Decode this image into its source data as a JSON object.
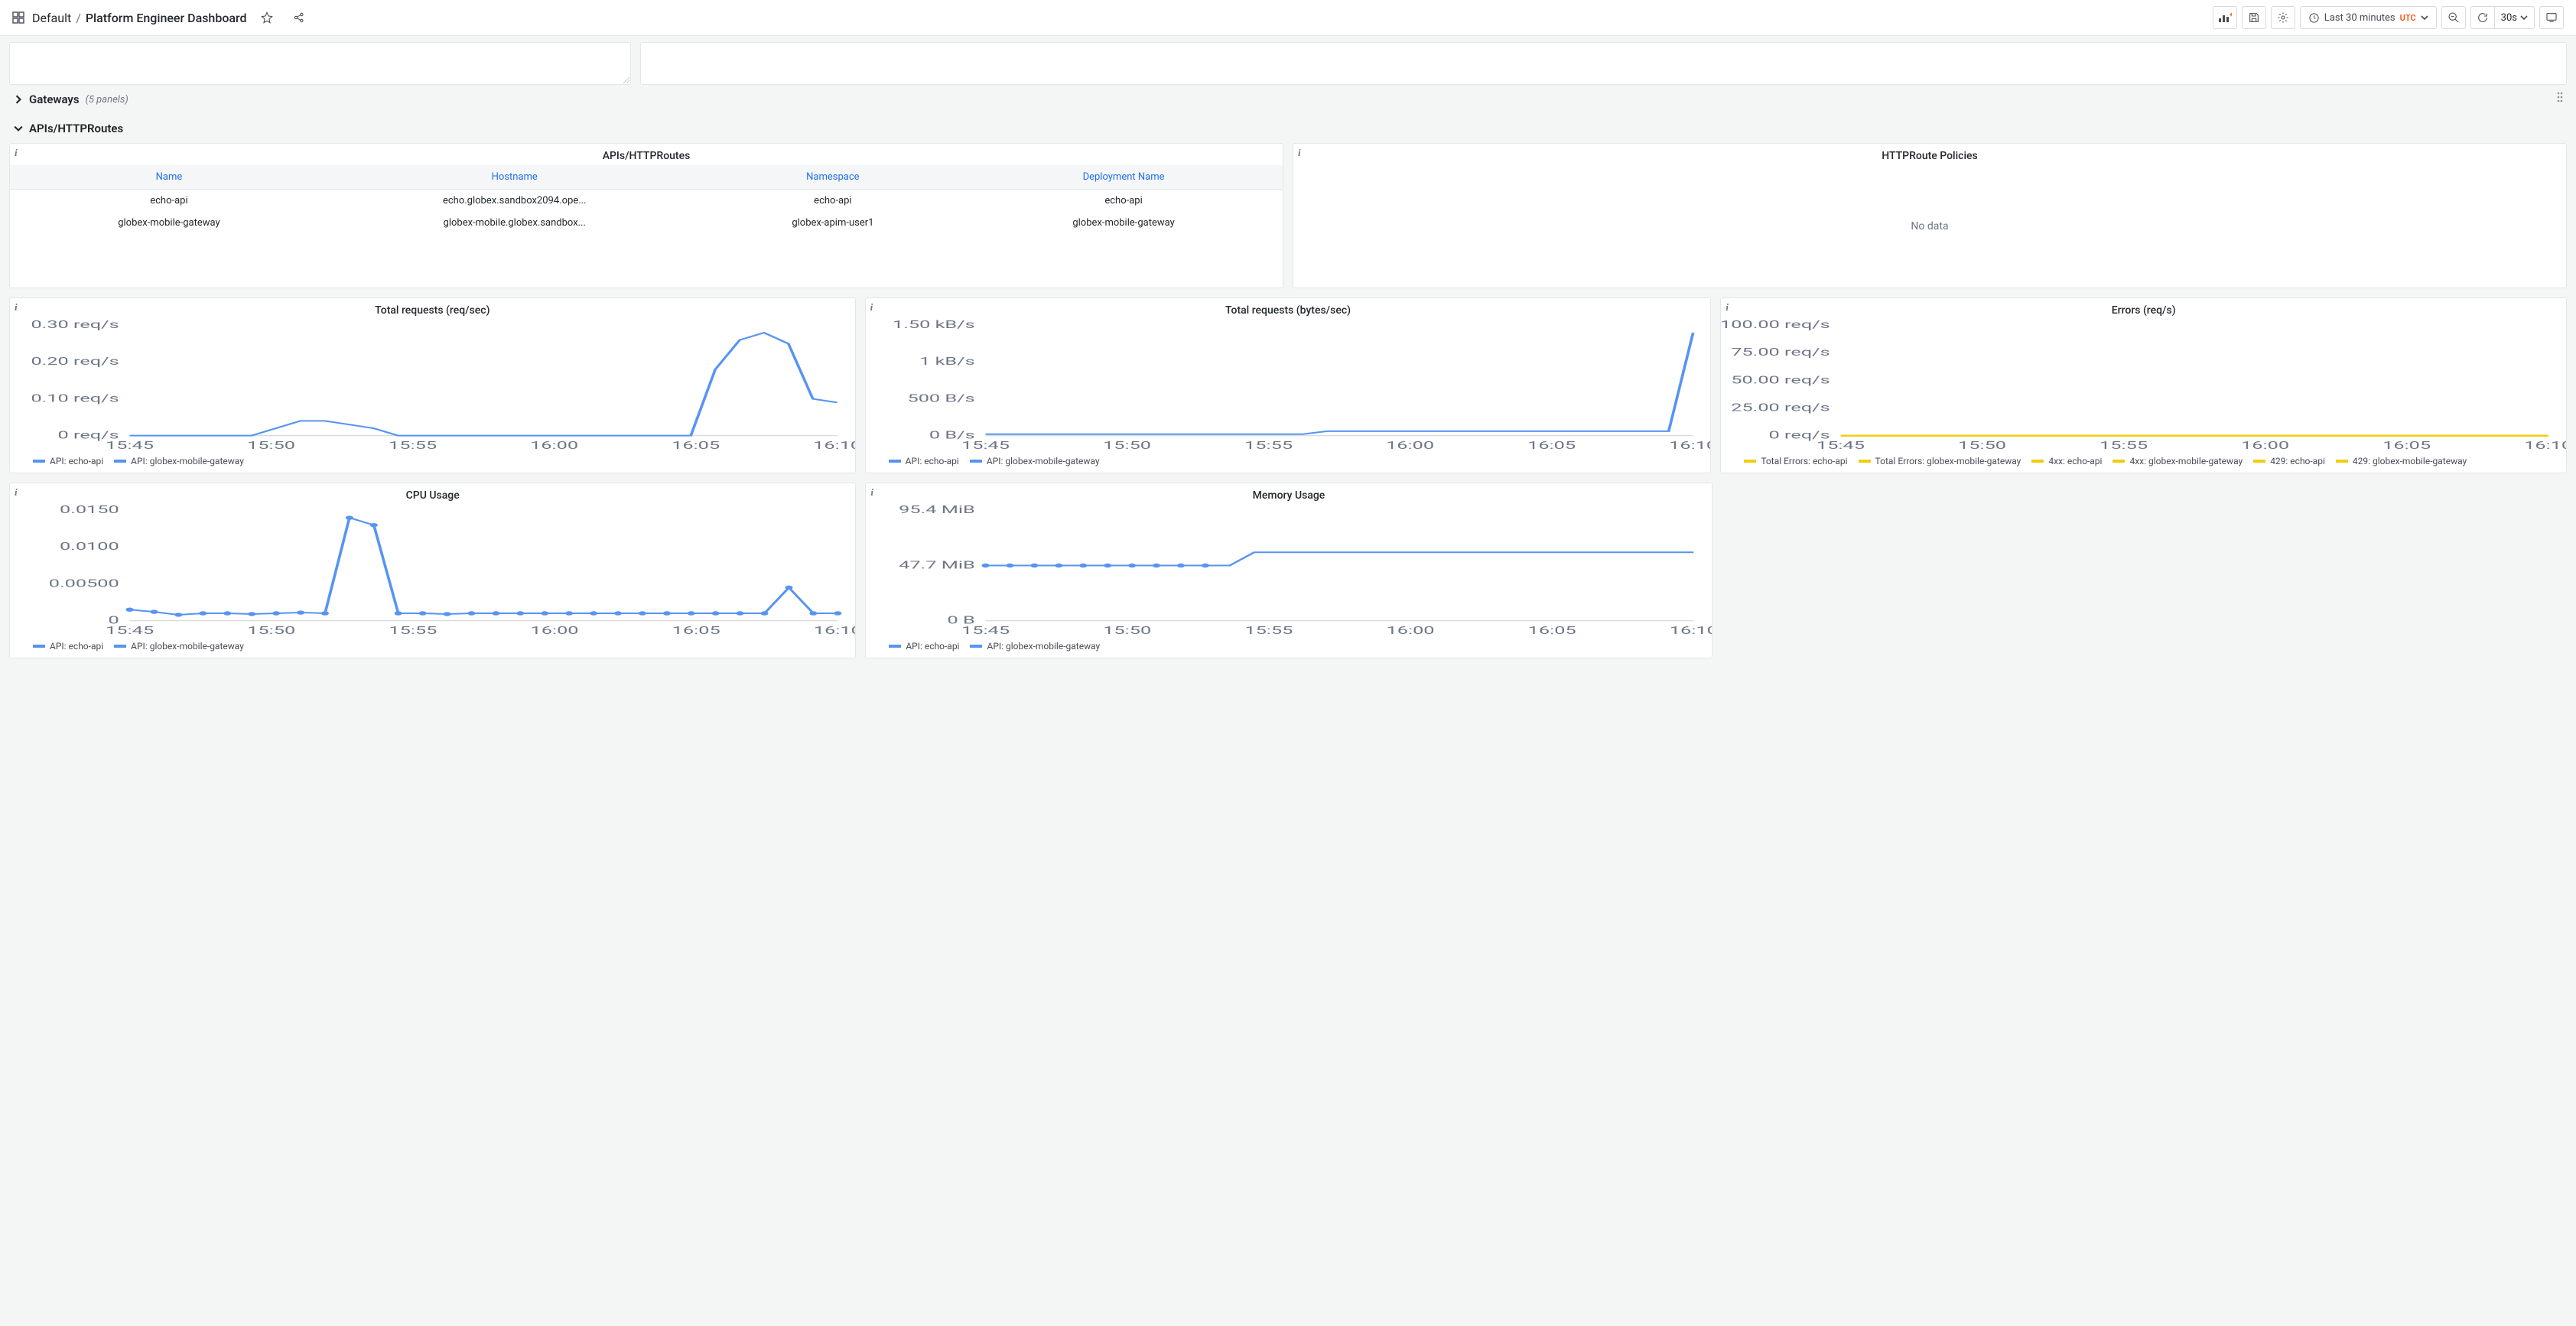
{
  "breadcrumb": {
    "root": "Default",
    "title": "Platform Engineer Dashboard"
  },
  "toolbar": {
    "time_label": "Last 30 minutes",
    "utc": "UTC",
    "refresh_interval": "30s"
  },
  "rows": {
    "gateways": {
      "title": "Gateways",
      "meta": "(5 panels)",
      "collapsed": true
    },
    "apis": {
      "title": "APIs/HTTPRoutes",
      "collapsed": false
    }
  },
  "table_panel": {
    "title": "APIs/HTTPRoutes",
    "headers": [
      "Name",
      "Hostname",
      "Namespace",
      "Deployment Name"
    ],
    "rows": [
      [
        "echo-api",
        "echo.globex.sandbox2094.ope...",
        "echo-api",
        "echo-api"
      ],
      [
        "globex-mobile-gateway",
        "globex-mobile.globex.sandbox...",
        "globex-apim-user1",
        "globex-mobile-gateway"
      ]
    ]
  },
  "policies_panel": {
    "title": "HTTPRoute Policies",
    "no_data": "No data"
  },
  "colors": {
    "blue": "#5794f2",
    "yellow": "#f2cc0c"
  },
  "chart_data": [
    {
      "id": "req_sec",
      "title": "Total requests (req/sec)",
      "type": "line",
      "x_ticks": [
        "15:45",
        "15:50",
        "15:55",
        "16:00",
        "16:05",
        "16:10"
      ],
      "y_ticks": [
        "0 req/s",
        "0.10 req/s",
        "0.20 req/s",
        "0.30 req/s"
      ],
      "ylim": [
        0,
        0.3
      ],
      "series": [
        {
          "name": "API: echo-api",
          "color": "blue",
          "x": [
            0,
            1,
            2,
            3,
            4,
            5,
            6,
            7,
            8,
            9,
            10,
            11,
            12,
            13,
            14,
            15,
            16,
            17,
            18,
            19,
            20,
            21,
            22,
            23,
            24,
            25,
            26,
            27,
            28,
            29
          ],
          "y": [
            0,
            0,
            0,
            0,
            0,
            0,
            0.02,
            0.04,
            0.04,
            0.03,
            0.02,
            0,
            0,
            0,
            0,
            0,
            0,
            0,
            0,
            0,
            0,
            0,
            0,
            0,
            0.18,
            0.26,
            0.28,
            0.25,
            0.1,
            0.09
          ]
        },
        {
          "name": "API: globex-mobile-gateway",
          "color": "blue",
          "x": [],
          "y": []
        }
      ]
    },
    {
      "id": "bytes_sec",
      "title": "Total requests (bytes/sec)",
      "type": "line",
      "x_ticks": [
        "15:45",
        "15:50",
        "15:55",
        "16:00",
        "16:05",
        "16:10"
      ],
      "y_ticks": [
        "0 B/s",
        "500 B/s",
        "1 kB/s",
        "1.50 kB/s"
      ],
      "ylim": [
        0,
        1500
      ],
      "series": [
        {
          "name": "API: echo-api",
          "color": "blue",
          "x": [
            0,
            1,
            2,
            3,
            4,
            5,
            6,
            7,
            8,
            9,
            10,
            11,
            12,
            13,
            14,
            15,
            16,
            17,
            18,
            19,
            20,
            21,
            22,
            23,
            24,
            25,
            26,
            27,
            28,
            29
          ],
          "y": [
            20,
            20,
            20,
            20,
            20,
            20,
            20,
            20,
            20,
            20,
            20,
            20,
            20,
            20,
            60,
            60,
            60,
            60,
            60,
            60,
            60,
            60,
            60,
            60,
            60,
            60,
            60,
            60,
            60,
            1400
          ]
        },
        {
          "name": "API: globex-mobile-gateway",
          "color": "blue",
          "x": [],
          "y": []
        }
      ]
    },
    {
      "id": "errors",
      "title": "Errors (req/s)",
      "type": "line",
      "x_ticks": [
        "15:45",
        "15:50",
        "15:55",
        "16:00",
        "16:05",
        "16:10"
      ],
      "y_ticks": [
        "0 req/s",
        "25.00 req/s",
        "50.00 req/s",
        "75.00 req/s",
        "100.00 req/s"
      ],
      "ylim": [
        0,
        100
      ],
      "series": [
        {
          "name": "Total Errors: echo-api",
          "color": "yellow",
          "x": [
            0,
            29
          ],
          "y": [
            0,
            0
          ]
        },
        {
          "name": "Total Errors: globex-mobile-gateway",
          "color": "yellow",
          "x": [
            0,
            29
          ],
          "y": [
            0,
            0
          ]
        },
        {
          "name": "4xx: echo-api",
          "color": "yellow",
          "x": [
            0,
            29
          ],
          "y": [
            0,
            0
          ]
        },
        {
          "name": "4xx: globex-mobile-gateway",
          "color": "yellow",
          "x": [
            0,
            29
          ],
          "y": [
            0,
            0
          ]
        },
        {
          "name": "429: echo-api",
          "color": "yellow",
          "x": [
            0,
            29
          ],
          "y": [
            0,
            0
          ]
        },
        {
          "name": "429: globex-mobile-gateway",
          "color": "yellow",
          "x": [
            0,
            29
          ],
          "y": [
            0,
            0
          ]
        }
      ]
    },
    {
      "id": "cpu",
      "title": "CPU Usage",
      "type": "line",
      "x_ticks": [
        "15:45",
        "15:50",
        "15:55",
        "16:00",
        "16:05",
        "16:10"
      ],
      "y_ticks": [
        "0",
        "0.00500",
        "0.0100",
        "0.0150"
      ],
      "ylim": [
        0,
        0.015
      ],
      "series": [
        {
          "name": "API: echo-api",
          "color": "blue",
          "markers": true,
          "x": [
            0,
            1,
            2,
            3,
            4,
            5,
            6,
            7,
            8,
            9,
            10,
            11,
            12,
            13,
            14,
            15,
            16,
            17,
            18,
            19,
            20,
            21,
            22,
            23,
            24,
            25,
            26,
            27,
            28,
            29
          ],
          "y": [
            0.0015,
            0.0012,
            0.0008,
            0.001,
            0.001,
            0.0009,
            0.001,
            0.0011,
            0.001,
            0.014,
            0.013,
            0.001,
            0.001,
            0.0009,
            0.001,
            0.001,
            0.001,
            0.001,
            0.001,
            0.001,
            0.001,
            0.001,
            0.001,
            0.001,
            0.001,
            0.001,
            0.001,
            0.0045,
            0.001,
            0.001
          ]
        },
        {
          "name": "API: globex-mobile-gateway",
          "color": "blue",
          "x": [],
          "y": []
        }
      ]
    },
    {
      "id": "mem",
      "title": "Memory Usage",
      "type": "line",
      "x_ticks": [
        "15:45",
        "15:50",
        "15:55",
        "16:00",
        "16:05",
        "16:10"
      ],
      "y_ticks": [
        "0 B",
        "47.7 MiB",
        "95.4 MiB"
      ],
      "ylim": [
        0,
        100
      ],
      "series": [
        {
          "name": "API: echo-api",
          "color": "blue",
          "markers": true,
          "x": [
            0,
            1,
            2,
            3,
            4,
            5,
            6,
            7,
            8,
            9,
            10,
            11,
            12,
            13,
            14,
            15,
            16,
            17,
            18,
            19,
            20,
            21,
            22,
            23,
            24,
            25,
            26,
            27,
            28,
            29
          ],
          "y": [
            50,
            50,
            50,
            50,
            50,
            50,
            50,
            50,
            50,
            50,
            50,
            62,
            62,
            62,
            62,
            62,
            62,
            62,
            62,
            62,
            62,
            62,
            62,
            62,
            62,
            62,
            62,
            62,
            62,
            62
          ],
          "marker_upto": 10
        },
        {
          "name": "API: globex-mobile-gateway",
          "color": "blue",
          "x": [],
          "y": []
        }
      ]
    }
  ]
}
